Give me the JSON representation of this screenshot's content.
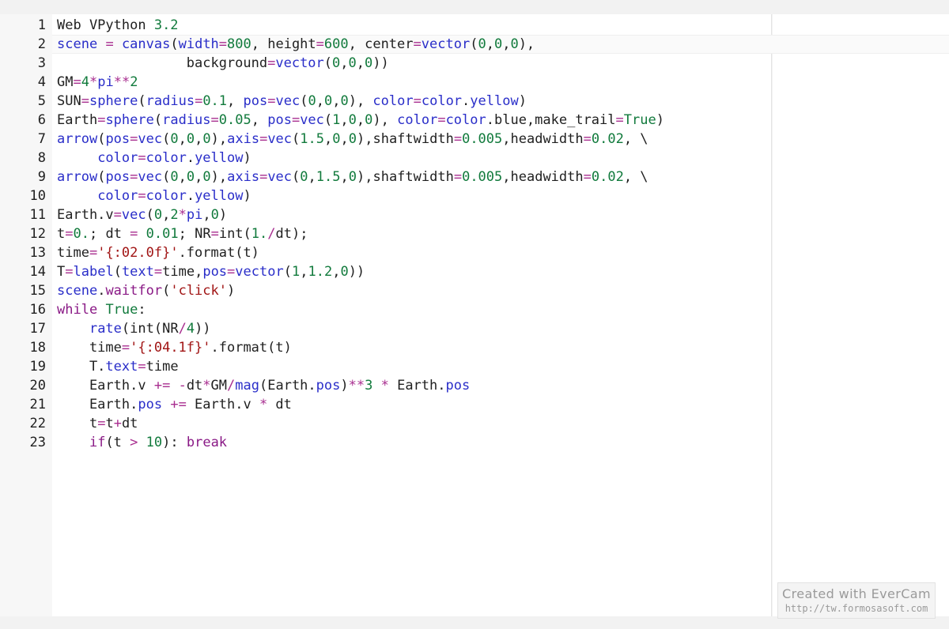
{
  "editor": {
    "lines": [
      {
        "n": "1",
        "tokens": [
          [
            "plain",
            "Web VPython "
          ],
          [
            "num",
            "3.2"
          ]
        ]
      },
      {
        "n": "2",
        "tokens": [
          [
            "builtin",
            "scene"
          ],
          [
            "plain",
            " "
          ],
          [
            "op",
            "="
          ],
          [
            "plain",
            " "
          ],
          [
            "builtin",
            "canvas"
          ],
          [
            "plain",
            "("
          ],
          [
            "builtin",
            "width"
          ],
          [
            "op",
            "="
          ],
          [
            "num",
            "800"
          ],
          [
            "plain",
            ", height"
          ],
          [
            "op",
            "="
          ],
          [
            "num",
            "600"
          ],
          [
            "plain",
            ", center"
          ],
          [
            "op",
            "="
          ],
          [
            "builtin",
            "vector"
          ],
          [
            "plain",
            "("
          ],
          [
            "num",
            "0"
          ],
          [
            "plain",
            ","
          ],
          [
            "num",
            "0"
          ],
          [
            "plain",
            ","
          ],
          [
            "num",
            "0"
          ],
          [
            "plain",
            "),"
          ]
        ]
      },
      {
        "n": "3",
        "tokens": [
          [
            "plain",
            "                background"
          ],
          [
            "op",
            "="
          ],
          [
            "builtin",
            "vector"
          ],
          [
            "plain",
            "("
          ],
          [
            "num",
            "0"
          ],
          [
            "plain",
            ","
          ],
          [
            "num",
            "0"
          ],
          [
            "plain",
            ","
          ],
          [
            "num",
            "0"
          ],
          [
            "plain",
            "))"
          ]
        ]
      },
      {
        "n": "4",
        "tokens": [
          [
            "plain",
            "GM"
          ],
          [
            "op",
            "="
          ],
          [
            "num",
            "4"
          ],
          [
            "op",
            "*"
          ],
          [
            "builtin",
            "pi"
          ],
          [
            "op",
            "**"
          ],
          [
            "num",
            "2"
          ]
        ]
      },
      {
        "n": "5",
        "tokens": [
          [
            "plain",
            "SUN"
          ],
          [
            "op",
            "="
          ],
          [
            "builtin",
            "sphere"
          ],
          [
            "plain",
            "("
          ],
          [
            "builtin",
            "radius"
          ],
          [
            "op",
            "="
          ],
          [
            "num",
            "0.1"
          ],
          [
            "plain",
            ", "
          ],
          [
            "builtin",
            "pos"
          ],
          [
            "op",
            "="
          ],
          [
            "builtin",
            "vec"
          ],
          [
            "plain",
            "("
          ],
          [
            "num",
            "0"
          ],
          [
            "plain",
            ","
          ],
          [
            "num",
            "0"
          ],
          [
            "plain",
            ","
          ],
          [
            "num",
            "0"
          ],
          [
            "plain",
            "), "
          ],
          [
            "builtin",
            "color"
          ],
          [
            "op",
            "="
          ],
          [
            "builtin",
            "color"
          ],
          [
            "plain",
            "."
          ],
          [
            "builtin",
            "yellow"
          ],
          [
            "plain",
            ")"
          ]
        ]
      },
      {
        "n": "6",
        "tokens": [
          [
            "plain",
            "Earth"
          ],
          [
            "op",
            "="
          ],
          [
            "builtin",
            "sphere"
          ],
          [
            "plain",
            "("
          ],
          [
            "builtin",
            "radius"
          ],
          [
            "op",
            "="
          ],
          [
            "num",
            "0.05"
          ],
          [
            "plain",
            ", "
          ],
          [
            "builtin",
            "pos"
          ],
          [
            "op",
            "="
          ],
          [
            "builtin",
            "vec"
          ],
          [
            "plain",
            "("
          ],
          [
            "num",
            "1"
          ],
          [
            "plain",
            ","
          ],
          [
            "num",
            "0"
          ],
          [
            "plain",
            ","
          ],
          [
            "num",
            "0"
          ],
          [
            "plain",
            "), "
          ],
          [
            "builtin",
            "color"
          ],
          [
            "op",
            "="
          ],
          [
            "builtin",
            "color"
          ],
          [
            "plain",
            ".blue,make_trail"
          ],
          [
            "op",
            "="
          ],
          [
            "num",
            "True"
          ],
          [
            "plain",
            ")"
          ]
        ]
      },
      {
        "n": "7",
        "tokens": [
          [
            "builtin",
            "arrow"
          ],
          [
            "plain",
            "("
          ],
          [
            "builtin",
            "pos"
          ],
          [
            "op",
            "="
          ],
          [
            "builtin",
            "vec"
          ],
          [
            "plain",
            "("
          ],
          [
            "num",
            "0"
          ],
          [
            "plain",
            ","
          ],
          [
            "num",
            "0"
          ],
          [
            "plain",
            ","
          ],
          [
            "num",
            "0"
          ],
          [
            "plain",
            "),"
          ],
          [
            "builtin",
            "axis"
          ],
          [
            "op",
            "="
          ],
          [
            "builtin",
            "vec"
          ],
          [
            "plain",
            "("
          ],
          [
            "num",
            "1.5"
          ],
          [
            "plain",
            ","
          ],
          [
            "num",
            "0"
          ],
          [
            "plain",
            ","
          ],
          [
            "num",
            "0"
          ],
          [
            "plain",
            "),shaftwidth"
          ],
          [
            "op",
            "="
          ],
          [
            "num",
            "0.005"
          ],
          [
            "plain",
            ",headwidth"
          ],
          [
            "op",
            "="
          ],
          [
            "num",
            "0.02"
          ],
          [
            "plain",
            ", \\"
          ]
        ]
      },
      {
        "n": "8",
        "tokens": [
          [
            "plain",
            "     "
          ],
          [
            "builtin",
            "color"
          ],
          [
            "op",
            "="
          ],
          [
            "builtin",
            "color"
          ],
          [
            "plain",
            "."
          ],
          [
            "builtin",
            "yellow"
          ],
          [
            "plain",
            ")"
          ]
        ]
      },
      {
        "n": "9",
        "tokens": [
          [
            "builtin",
            "arrow"
          ],
          [
            "plain",
            "("
          ],
          [
            "builtin",
            "pos"
          ],
          [
            "op",
            "="
          ],
          [
            "builtin",
            "vec"
          ],
          [
            "plain",
            "("
          ],
          [
            "num",
            "0"
          ],
          [
            "plain",
            ","
          ],
          [
            "num",
            "0"
          ],
          [
            "plain",
            ","
          ],
          [
            "num",
            "0"
          ],
          [
            "plain",
            "),"
          ],
          [
            "builtin",
            "axis"
          ],
          [
            "op",
            "="
          ],
          [
            "builtin",
            "vec"
          ],
          [
            "plain",
            "("
          ],
          [
            "num",
            "0"
          ],
          [
            "plain",
            ","
          ],
          [
            "num",
            "1.5"
          ],
          [
            "plain",
            ","
          ],
          [
            "num",
            "0"
          ],
          [
            "plain",
            "),shaftwidth"
          ],
          [
            "op",
            "="
          ],
          [
            "num",
            "0.005"
          ],
          [
            "plain",
            ",headwidth"
          ],
          [
            "op",
            "="
          ],
          [
            "num",
            "0.02"
          ],
          [
            "plain",
            ", \\"
          ]
        ]
      },
      {
        "n": "10",
        "tokens": [
          [
            "plain",
            "     "
          ],
          [
            "builtin",
            "color"
          ],
          [
            "op",
            "="
          ],
          [
            "builtin",
            "color"
          ],
          [
            "plain",
            "."
          ],
          [
            "builtin",
            "yellow"
          ],
          [
            "plain",
            ")"
          ]
        ]
      },
      {
        "n": "11",
        "tokens": [
          [
            "plain",
            "Earth.v"
          ],
          [
            "op",
            "="
          ],
          [
            "builtin",
            "vec"
          ],
          [
            "plain",
            "("
          ],
          [
            "num",
            "0"
          ],
          [
            "plain",
            ","
          ],
          [
            "num",
            "2"
          ],
          [
            "op",
            "*"
          ],
          [
            "builtin",
            "pi"
          ],
          [
            "plain",
            ","
          ],
          [
            "num",
            "0"
          ],
          [
            "plain",
            ")"
          ]
        ]
      },
      {
        "n": "12",
        "tokens": [
          [
            "plain",
            "t"
          ],
          [
            "op",
            "="
          ],
          [
            "num",
            "0."
          ],
          [
            "plain",
            "; dt "
          ],
          [
            "op",
            "="
          ],
          [
            "plain",
            " "
          ],
          [
            "num",
            "0.01"
          ],
          [
            "plain",
            "; NR"
          ],
          [
            "op",
            "="
          ],
          [
            "plain",
            "int("
          ],
          [
            "num",
            "1."
          ],
          [
            "op",
            "/"
          ],
          [
            "plain",
            "dt);"
          ]
        ]
      },
      {
        "n": "13",
        "tokens": [
          [
            "plain",
            "time"
          ],
          [
            "op",
            "="
          ],
          [
            "str",
            "'{:02.0f}'"
          ],
          [
            "plain",
            ".format(t)"
          ]
        ]
      },
      {
        "n": "14",
        "tokens": [
          [
            "plain",
            "T"
          ],
          [
            "op",
            "="
          ],
          [
            "builtin",
            "label"
          ],
          [
            "plain",
            "("
          ],
          [
            "builtin",
            "text"
          ],
          [
            "op",
            "="
          ],
          [
            "plain",
            "time,"
          ],
          [
            "builtin",
            "pos"
          ],
          [
            "op",
            "="
          ],
          [
            "builtin",
            "vector"
          ],
          [
            "plain",
            "("
          ],
          [
            "num",
            "1"
          ],
          [
            "plain",
            ","
          ],
          [
            "num",
            "1.2"
          ],
          [
            "plain",
            ","
          ],
          [
            "num",
            "0"
          ],
          [
            "plain",
            "))"
          ]
        ]
      },
      {
        "n": "15",
        "tokens": [
          [
            "builtin",
            "scene"
          ],
          [
            "plain",
            "."
          ],
          [
            "kw",
            "waitfor"
          ],
          [
            "plain",
            "("
          ],
          [
            "str",
            "'click'"
          ],
          [
            "plain",
            ")"
          ]
        ]
      },
      {
        "n": "16",
        "tokens": [
          [
            "kw",
            "while"
          ],
          [
            "plain",
            " "
          ],
          [
            "num",
            "True"
          ],
          [
            "plain",
            ":"
          ]
        ]
      },
      {
        "n": "17",
        "tokens": [
          [
            "plain",
            "    "
          ],
          [
            "builtin",
            "rate"
          ],
          [
            "plain",
            "(int(NR"
          ],
          [
            "op",
            "/"
          ],
          [
            "num",
            "4"
          ],
          [
            "plain",
            "))"
          ]
        ]
      },
      {
        "n": "18",
        "tokens": [
          [
            "plain",
            "    time"
          ],
          [
            "op",
            "="
          ],
          [
            "str",
            "'{:04.1f}'"
          ],
          [
            "plain",
            ".format(t)"
          ]
        ]
      },
      {
        "n": "19",
        "tokens": [
          [
            "plain",
            "    T."
          ],
          [
            "builtin",
            "text"
          ],
          [
            "op",
            "="
          ],
          [
            "plain",
            "time"
          ]
        ]
      },
      {
        "n": "20",
        "tokens": [
          [
            "plain",
            "    Earth.v "
          ],
          [
            "op",
            "+="
          ],
          [
            "plain",
            " "
          ],
          [
            "op",
            "-"
          ],
          [
            "plain",
            "dt"
          ],
          [
            "op",
            "*"
          ],
          [
            "plain",
            "GM"
          ],
          [
            "op",
            "/"
          ],
          [
            "builtin",
            "mag"
          ],
          [
            "plain",
            "(Earth."
          ],
          [
            "builtin",
            "pos"
          ],
          [
            "plain",
            ")"
          ],
          [
            "op",
            "**"
          ],
          [
            "num",
            "3"
          ],
          [
            "plain",
            " "
          ],
          [
            "op",
            "*"
          ],
          [
            "plain",
            " Earth."
          ],
          [
            "builtin",
            "pos"
          ]
        ]
      },
      {
        "n": "21",
        "tokens": [
          [
            "plain",
            "    Earth."
          ],
          [
            "builtin",
            "pos"
          ],
          [
            "plain",
            " "
          ],
          [
            "op",
            "+="
          ],
          [
            "plain",
            " Earth.v "
          ],
          [
            "op",
            "*"
          ],
          [
            "plain",
            " dt"
          ]
        ]
      },
      {
        "n": "22",
        "tokens": [
          [
            "plain",
            "    t"
          ],
          [
            "op",
            "="
          ],
          [
            "plain",
            "t"
          ],
          [
            "op",
            "+"
          ],
          [
            "plain",
            "dt"
          ]
        ]
      },
      {
        "n": "23",
        "tokens": [
          [
            "plain",
            "    "
          ],
          [
            "kw",
            "if"
          ],
          [
            "plain",
            "(t "
          ],
          [
            "op",
            ">"
          ],
          [
            "plain",
            " "
          ],
          [
            "num",
            "10"
          ],
          [
            "plain",
            "): "
          ],
          [
            "kw",
            "break"
          ]
        ]
      }
    ]
  },
  "watermark": {
    "title": "Created with EverCam",
    "url": "http://tw.formosasoft.com"
  },
  "colors": {
    "keyword": "#8a1a86",
    "builtin": "#2a2ec9",
    "number": "#117a3c",
    "string": "#a11515",
    "operator": "#a82d8f"
  }
}
